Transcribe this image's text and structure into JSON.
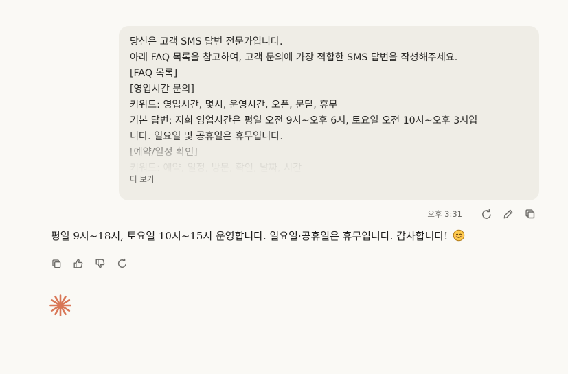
{
  "user_message": {
    "lines": [
      "당신은 고객 SMS 답변 전문가입니다.",
      "아래 FAQ 목록을 참고하여, 고객 문의에 가장 적합한 SMS 답변을 작성해주세요.",
      "[FAQ 목록]",
      "[영업시간 문의]",
      "키워드: 영업시간, 몇시, 운영시간, 오픈, 문닫, 휴무",
      "기본 답변: 저희 영업시간은 평일 오전 9시~오후 6시, 토요일 오전 10시~오후 3시입",
      "니다. 일요일 및 공휴일은 휴무입니다.",
      "[예약/일정 확인]",
      "키워드: 예약, 일정, 방문, 확인, 날짜, 시간"
    ],
    "show_more_label": "더 보기",
    "timestamp": "오후 3:31"
  },
  "user_actions": {
    "icons": [
      "retry-icon",
      "edit-icon",
      "copy-icon"
    ]
  },
  "assistant_message": {
    "text": "평일 9시~18시, 토요일 10시~15시 운영합니다. 일요일·공휴일은 휴무입니다. 감사합니다! ",
    "emoji": "smiling-face-emoji"
  },
  "assistant_actions": {
    "icons": [
      "copy-icon",
      "thumbs-up-icon",
      "thumbs-down-icon",
      "retry-icon"
    ]
  },
  "colors": {
    "background": "#faf9f5",
    "user_bubble": "#efede6",
    "logo": "#d97757",
    "muted_text": "#6b6a66"
  }
}
